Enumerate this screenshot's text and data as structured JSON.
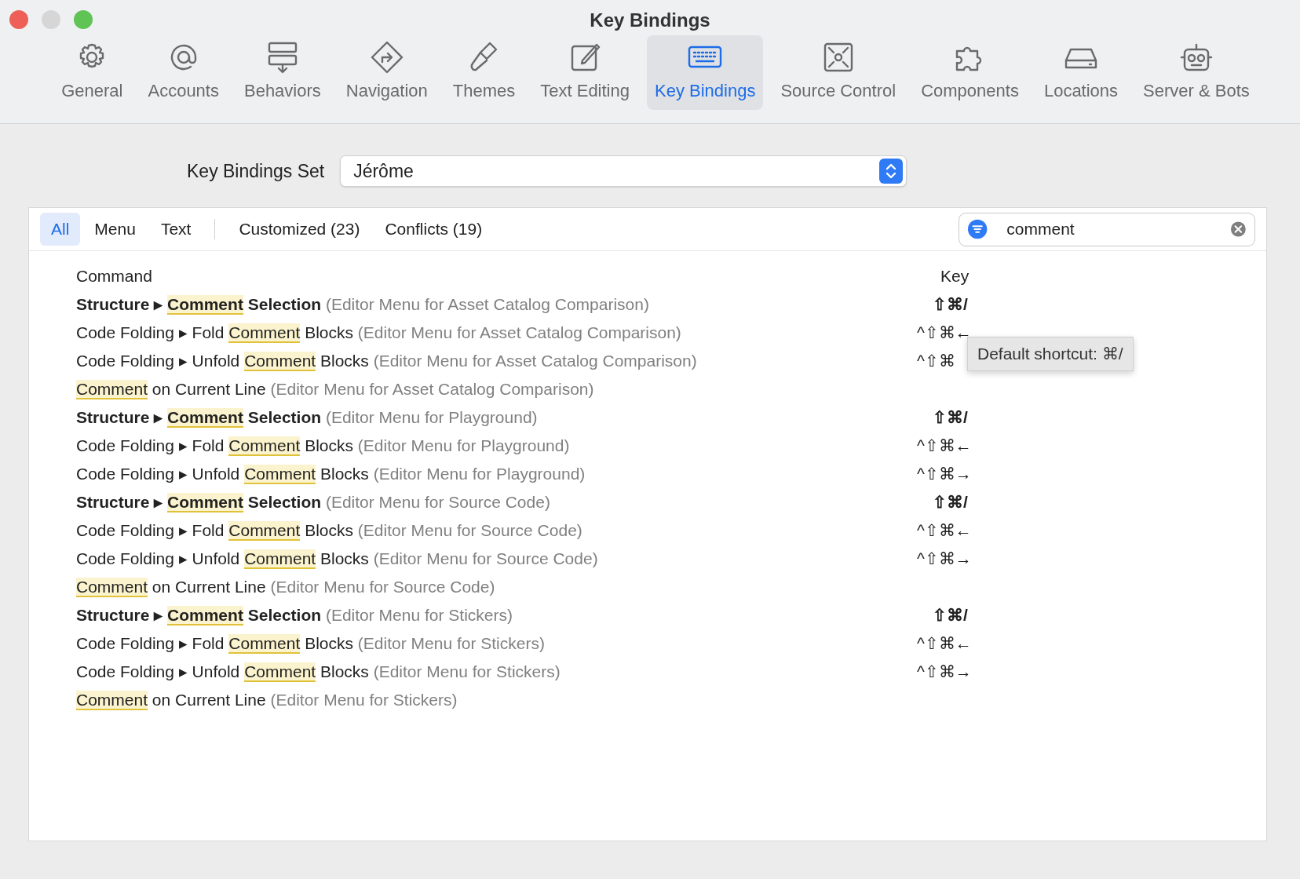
{
  "window": {
    "title": "Key Bindings"
  },
  "toolbar": [
    {
      "label": "General",
      "selected": false
    },
    {
      "label": "Accounts",
      "selected": false
    },
    {
      "label": "Behaviors",
      "selected": false
    },
    {
      "label": "Navigation",
      "selected": false
    },
    {
      "label": "Themes",
      "selected": false
    },
    {
      "label": "Text Editing",
      "selected": false
    },
    {
      "label": "Key Bindings",
      "selected": true
    },
    {
      "label": "Source Control",
      "selected": false
    },
    {
      "label": "Components",
      "selected": false
    },
    {
      "label": "Locations",
      "selected": false
    },
    {
      "label": "Server & Bots",
      "selected": false
    }
  ],
  "key_bindings_set": {
    "label": "Key Bindings Set",
    "value": "Jérôme"
  },
  "filter_tabs": [
    {
      "label": "All",
      "selected": true
    },
    {
      "label": "Menu",
      "selected": false
    },
    {
      "label": "Text",
      "selected": false
    },
    {
      "label": "Customized (23)",
      "selected": false
    },
    {
      "label": "Conflicts (19)",
      "selected": false
    }
  ],
  "search": {
    "value": "comment"
  },
  "table": {
    "columns": [
      "Command",
      "Key"
    ],
    "rows": [
      {
        "before": "Structure ▸ ",
        "match": "Comment",
        "after": " Selection",
        "context": "(Editor Menu for Asset Catalog Comparison)",
        "key": "⇧⌘/",
        "customized": true
      },
      {
        "before": "Code Folding ▸ Fold ",
        "match": "Comment",
        "after": " Blocks",
        "context": "(Editor Menu for Asset Catalog Comparison)",
        "key": "^⇧⌘←",
        "customized": false
      },
      {
        "before": "Code Folding ▸ Unfold ",
        "match": "Comment",
        "after": " Blocks",
        "context": "(Editor Menu for Asset Catalog Comparison)",
        "key": "^⇧⌘",
        "customized": false
      },
      {
        "before": "",
        "match": "Comment",
        "after": " on Current Line",
        "context": "(Editor Menu for Asset Catalog Comparison)",
        "key": "",
        "customized": false
      },
      {
        "before": "Structure ▸ ",
        "match": "Comment",
        "after": " Selection",
        "context": "(Editor Menu for Playground)",
        "key": "⇧⌘/",
        "customized": true
      },
      {
        "before": "Code Folding ▸ Fold ",
        "match": "Comment",
        "after": " Blocks",
        "context": "(Editor Menu for Playground)",
        "key": "^⇧⌘←",
        "customized": false
      },
      {
        "before": "Code Folding ▸ Unfold ",
        "match": "Comment",
        "after": " Blocks",
        "context": "(Editor Menu for Playground)",
        "key": "^⇧⌘→",
        "customized": false
      },
      {
        "before": "Structure ▸ ",
        "match": "Comment",
        "after": " Selection",
        "context": "(Editor Menu for Source Code)",
        "key": "⇧⌘/",
        "customized": true
      },
      {
        "before": "Code Folding ▸ Fold ",
        "match": "Comment",
        "after": " Blocks",
        "context": "(Editor Menu for Source Code)",
        "key": "^⇧⌘←",
        "customized": false
      },
      {
        "before": "Code Folding ▸ Unfold ",
        "match": "Comment",
        "after": " Blocks",
        "context": "(Editor Menu for Source Code)",
        "key": "^⇧⌘→",
        "customized": false
      },
      {
        "before": "",
        "match": "Comment",
        "after": " on Current Line",
        "context": "(Editor Menu for Source Code)",
        "key": "",
        "customized": false
      },
      {
        "before": "Structure ▸ ",
        "match": "Comment",
        "after": " Selection",
        "context": "(Editor Menu for Stickers)",
        "key": "⇧⌘/",
        "customized": true
      },
      {
        "before": "Code Folding ▸ Fold ",
        "match": "Comment",
        "after": " Blocks",
        "context": "(Editor Menu for Stickers)",
        "key": "^⇧⌘←",
        "customized": false
      },
      {
        "before": "Code Folding ▸ Unfold ",
        "match": "Comment",
        "after": " Blocks",
        "context": "(Editor Menu for Stickers)",
        "key": "^⇧⌘→",
        "customized": false
      },
      {
        "before": "",
        "match": "Comment",
        "after": " on Current Line",
        "context": "(Editor Menu for Stickers)",
        "key": "",
        "customized": false
      }
    ]
  },
  "tooltip": {
    "text": "Default shortcut: ⌘/"
  }
}
